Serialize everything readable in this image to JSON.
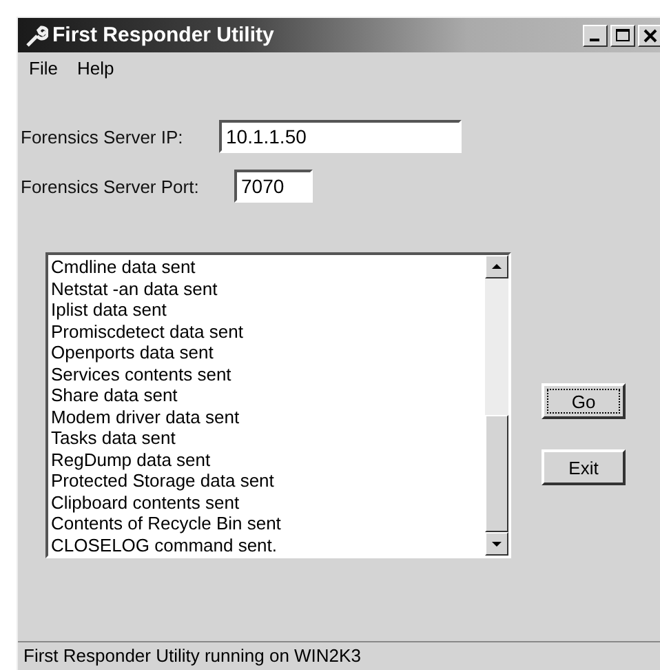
{
  "window": {
    "title": "First Responder Utility"
  },
  "menu": [
    {
      "label": "File"
    },
    {
      "label": "Help"
    }
  ],
  "fields": [
    {
      "label": "Forensics Server IP:",
      "value": "10.1.1.50"
    },
    {
      "label": "Forensics Server Port:",
      "value": "7070"
    }
  ],
  "log": [
    "Cmdline data sent",
    "Netstat -an data sent",
    "Iplist data sent",
    "Promiscdetect data sent",
    "Openports data sent",
    "Services contents sent",
    "Share data sent",
    "Modem driver data sent",
    "Tasks data sent",
    "RegDump data sent",
    "Protected Storage data sent",
    "Clipboard contents sent",
    "Contents of Recycle Bin sent",
    "CLOSELOG command sent."
  ],
  "buttons": [
    {
      "label": "Go",
      "focused": true
    },
    {
      "label": "Exit",
      "focused": false
    }
  ],
  "status_bar": "First Responder Utility running on WIN2K3"
}
